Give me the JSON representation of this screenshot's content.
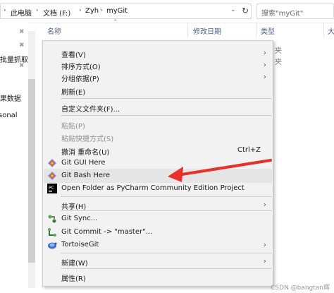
{
  "address_bar": {
    "crumbs": [
      "此电脑",
      "文档 (F:)",
      "Zyh",
      "myGit"
    ],
    "search_placeholder": "搜索\"myGit\""
  },
  "nav_pane": {
    "items": [
      "t批量抓取",
      "t果数据",
      "sonal"
    ]
  },
  "columns": {
    "name": "名称",
    "modified": "修改日期",
    "type": "类型",
    "size": "大"
  },
  "background_rows": [
    "夹",
    "夹"
  ],
  "context_menu": {
    "items": [
      {
        "label": "查看(V)",
        "submenu": true
      },
      {
        "label": "排序方式(O)",
        "submenu": true
      },
      {
        "label": "分组依据(P)",
        "submenu": true
      },
      {
        "label": "刷新(E)"
      },
      {
        "label": "自定义文件夹(F)..."
      },
      {
        "label": "粘贴(P)",
        "disabled": true
      },
      {
        "label": "粘贴快捷方式(S)",
        "disabled": true
      },
      {
        "label": "撤消 重命名(U)",
        "shortcut": "Ctrl+Z"
      },
      {
        "label": "Git GUI Here",
        "icon": "git-diamond-icon"
      },
      {
        "label": "Git Bash Here",
        "icon": "git-diamond-icon",
        "highlighted": true
      },
      {
        "label": "Open Folder as PyCharm Community Edition Project",
        "icon": "pycharm-icon"
      },
      {
        "label": "共享(H)",
        "submenu": true
      },
      {
        "label": "Git Sync...",
        "icon": "git-sync-icon"
      },
      {
        "label": "Git Commit -> \"master\"...",
        "icon": "git-commit-icon"
      },
      {
        "label": "TortoiseGit",
        "icon": "tortoisegit-icon",
        "submenu": true
      },
      {
        "label": "新建(W)",
        "submenu": true
      },
      {
        "label": "属性(R)"
      }
    ]
  },
  "arrow_color": "#e8302a",
  "highlight_color": "#e5e5e5",
  "watermark": "CSDN @bangtan辉"
}
